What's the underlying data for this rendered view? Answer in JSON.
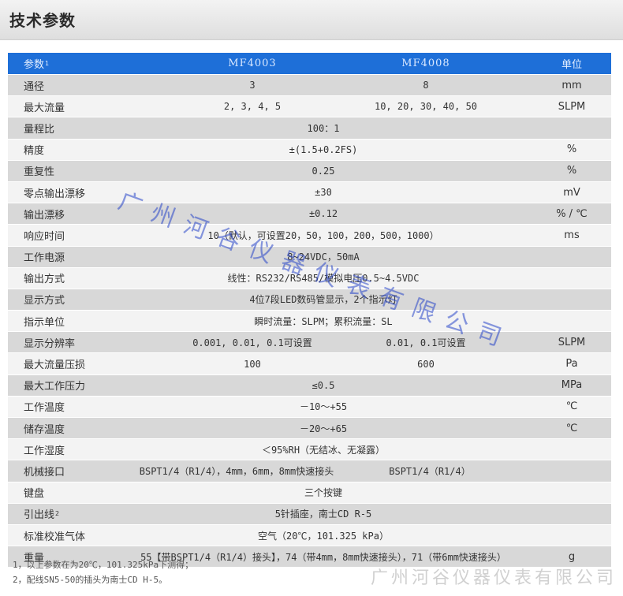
{
  "title": "技术参数",
  "header": {
    "param": "参数",
    "mark": "1",
    "a": "MF4003",
    "b": "MF4008",
    "unit": "单位"
  },
  "rows": [
    {
      "param": "通径",
      "a": "3",
      "b": "8",
      "unit": "mm"
    },
    {
      "param": "最大流量",
      "a": "2, 3, 4, 5",
      "b": "10, 20, 30, 40, 50",
      "unit": "SLPM"
    },
    {
      "param": "量程比",
      "span": "100：1",
      "unit": ""
    },
    {
      "param": "精度",
      "span": "±(1.5+0.2FS)",
      "unit": "%"
    },
    {
      "param": "重复性",
      "span": "0.25",
      "unit": "%"
    },
    {
      "param": "零点输出漂移",
      "span": "±30",
      "unit": "mV"
    },
    {
      "param": "输出漂移",
      "span": "±0.12",
      "unit": "% / ℃"
    },
    {
      "param": "响应时间",
      "span": "10（默认，可设置20，50，100，200，500，1000）",
      "unit": "ms"
    },
    {
      "param": "工作电源",
      "span": "8~24VDC，50mA",
      "unit": ""
    },
    {
      "param": "输出方式",
      "span": "线性：RS232/RS485/模拟电压0.5~4.5VDC",
      "unit": ""
    },
    {
      "param": "显示方式",
      "span": "4位7段LED数码管显示，2个指示灯",
      "unit": ""
    },
    {
      "param": "指示单位",
      "span": "瞬时流量：SLPM；累积流量：SL",
      "unit": ""
    },
    {
      "param": "显示分辨率",
      "a": "0.001, 0.01, 0.1可设置",
      "b": "0.01, 0.1可设置",
      "unit": "SLPM"
    },
    {
      "param": "最大流量压损",
      "a": "100",
      "b": "600",
      "unit": "Pa"
    },
    {
      "param": "最大工作压力",
      "span": "≤0.5",
      "unit": "MPa"
    },
    {
      "param": "工作温度",
      "span": "－10～+55",
      "unit": "℃"
    },
    {
      "param": "储存温度",
      "span": "－20～+65",
      "unit": "℃"
    },
    {
      "param": "工作湿度",
      "span": "＜95%RH（无结冰、无凝露）",
      "unit": ""
    },
    {
      "param": "机械接口",
      "a": "BSPT1/4（R1/4），4mm，6mm，8mm快速接头",
      "b": "BSPT1/4（R1/4）",
      "unit": ""
    },
    {
      "param": "键盘",
      "span": "三个按键",
      "unit": ""
    },
    {
      "param": "引出线",
      "mark": "2",
      "span": "5针插座，南士CD R-5",
      "unit": ""
    },
    {
      "param": "标准校准气体",
      "span": "空气（20℃，101.325 kPa）",
      "unit": ""
    },
    {
      "param": "重量",
      "span": "55【带BSPT1/4（R1/4）接头】，74（带4mm，8mm快速接头），71（带6mm快速接头）",
      "unit": "g"
    }
  ],
  "notes": [
    "1，以上参数在为20℃，101.325kPa下测得；",
    "2，配线SN5-50的插头为南士CD H-5。"
  ],
  "watermark_diag": "广州河谷仪器仪表有限公司",
  "watermark_bottom": "广州河谷仪器仪表有限公司",
  "colors": {
    "header_bg": "#1e6fd8",
    "shaded_row": "#d8d8d8",
    "plain_row": "#f3f3f3"
  }
}
